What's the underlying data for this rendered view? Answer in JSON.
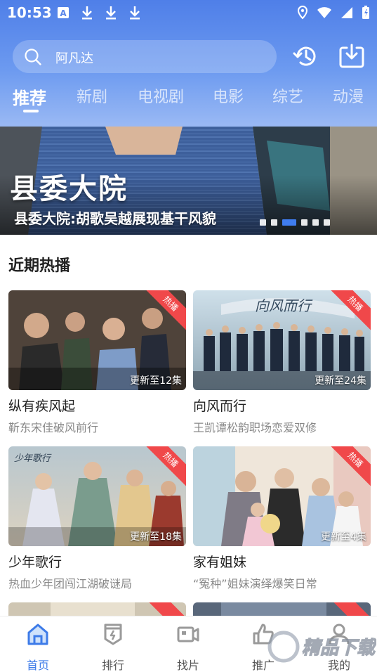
{
  "status_bar": {
    "time": "10:53"
  },
  "search": {
    "placeholder": "阿凡达"
  },
  "tabs": [
    {
      "label": "推荐",
      "active": true
    },
    {
      "label": "新剧"
    },
    {
      "label": "电视剧"
    },
    {
      "label": "电影"
    },
    {
      "label": "综艺"
    },
    {
      "label": "动漫"
    }
  ],
  "banner": {
    "title": "县委大院",
    "subtitle": "县委大院:胡歌吴越展现基干风貌",
    "dot_count": 6,
    "active_dot": 2
  },
  "section": {
    "title": "近期热播"
  },
  "cards": [
    {
      "title": "纵有疾风起",
      "desc": "靳东宋佳破风前行",
      "badge": "热播",
      "episode": "更新至12集"
    },
    {
      "title": "向风而行",
      "desc": "王凯谭松韵职场恋爱双修",
      "badge": "热播",
      "episode": "更新至24集",
      "poster_text": "向风而行"
    },
    {
      "title": "少年歌行",
      "desc": "热血少年团闯江湖破谜局",
      "badge": "热播",
      "episode": "更新至18集",
      "poster_text": "少年歌行"
    },
    {
      "title": "家有姐妹",
      "desc": "“冤种”姐妹演绎爆笑日常",
      "badge": "热播",
      "episode": "更新至4集"
    }
  ],
  "bottom_nav": [
    {
      "label": "首页",
      "icon": "home-icon",
      "active": true
    },
    {
      "label": "排行",
      "icon": "ranking-icon"
    },
    {
      "label": "找片",
      "icon": "video-camera-icon"
    },
    {
      "label": "推广",
      "icon": "promote-icon"
    },
    {
      "label": "我的",
      "icon": "user-icon"
    }
  ],
  "watermark": {
    "text": "精品下载"
  },
  "colors": {
    "accent": "#3d7be8",
    "header_top": "#4f7fe8",
    "hot_badge": "#f0484a"
  }
}
